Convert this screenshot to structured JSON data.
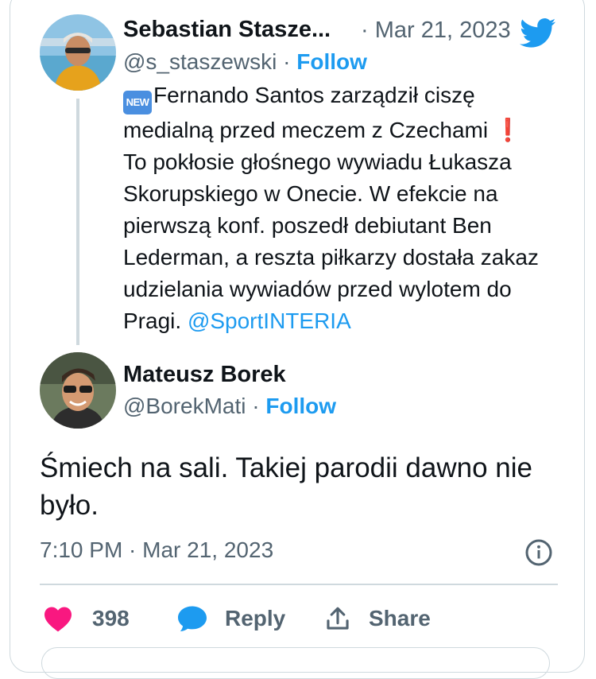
{
  "quoted_tweet": {
    "author_name": "Sebastian Stasze...",
    "handle": "@s_staszewski",
    "follow_label": "Follow",
    "date": "· Mar 21, 2023",
    "badge": "NEW",
    "text_line1": "Fernando Santos zarządził ciszę medialną przed meczem z Czechami",
    "text_exclaim": "❗",
    "text_line2": "To pokłosie głośnego wywiadu Łukasza Skorupskiego w Onecie. W efekcie na pierwszą konf. poszedł debiutant Ben Lederman, a reszta piłkarzy dostała zakaz udzielania wywiadów przed wylotem do Pragi.",
    "mention": "@SportINTERIA"
  },
  "reply_tweet": {
    "author_name": "Mateusz Borek",
    "handle": "@BorekMati",
    "separator": "·",
    "follow_label": "Follow",
    "text": "Śmiech na sali. Takiej parodii dawno nie było.",
    "timestamp": "7:10 PM · Mar 21, 2023"
  },
  "actions": {
    "likes_count": "398",
    "reply_label": "Reply",
    "share_label": "Share"
  },
  "icons": {
    "brand": "twitter-bird-icon",
    "like": "heart-icon",
    "reply": "speech-bubble-icon",
    "share": "share-upload-icon",
    "info": "info-icon"
  },
  "colors": {
    "accent": "#1d9bf0",
    "like": "#f91880",
    "text": "#0f1419",
    "muted": "#536471",
    "border": "#cfd9de"
  }
}
